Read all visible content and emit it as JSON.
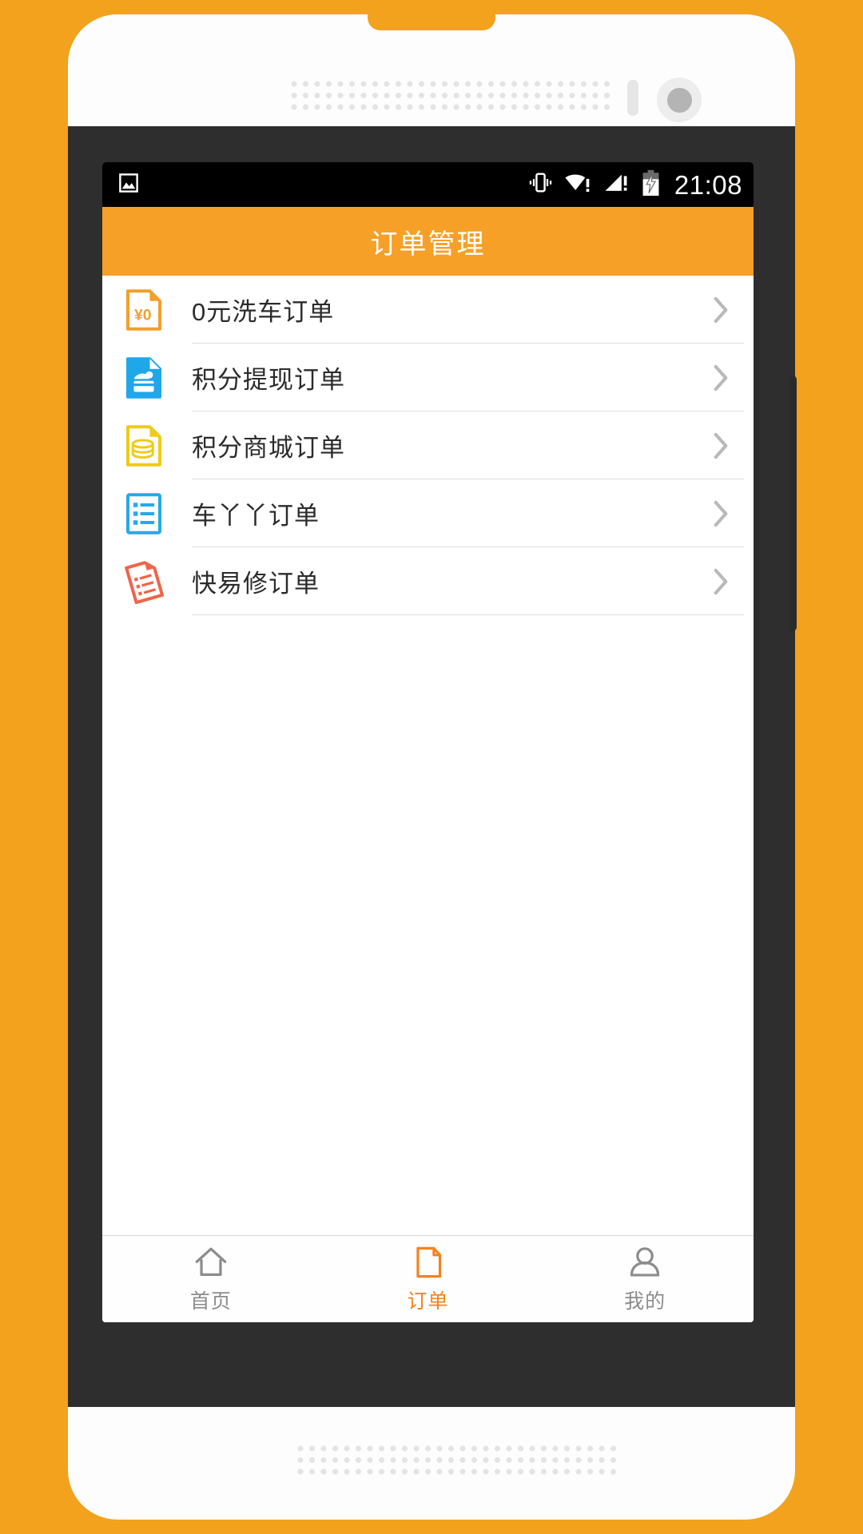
{
  "device": {
    "frame_color": "#FDFDFD",
    "bezel_color": "#2E2E2E",
    "background_color": "#F2A21C",
    "earpiece_name": "earpiece-speaker-grille",
    "camera_name": "front-camera",
    "home_name": "home-speaker-grille"
  },
  "status_bar": {
    "background": "#000000",
    "left_icons": [
      {
        "name": "image-notification-icon",
        "glyph": "picture"
      }
    ],
    "right_icons": [
      {
        "name": "vibrate-icon",
        "glyph": "vibrate"
      },
      {
        "name": "wifi-warning-icon",
        "glyph": "wifi-exclaim"
      },
      {
        "name": "cell-signal-warning-icon",
        "glyph": "signal-exclaim"
      },
      {
        "name": "battery-charging-icon",
        "glyph": "battery-bolt"
      }
    ],
    "clock": "21:08"
  },
  "title_bar": {
    "title": "订单管理",
    "background": "#F7A028",
    "text_color": "#FFFFFF"
  },
  "order_list": {
    "items": [
      {
        "label": "0元洗车订单",
        "icon_name": "zero-yuan-carwash-doc-icon",
        "icon_color": "#F2A02B",
        "icon_text": "¥0"
      },
      {
        "label": "积分提现订单",
        "icon_name": "points-withdraw-card-doc-icon",
        "icon_color": "#1FA7EA",
        "icon_text": ""
      },
      {
        "label": "积分商城订单",
        "icon_name": "points-mall-database-doc-icon",
        "icon_color": "#EFCB18",
        "icon_text": ""
      },
      {
        "label": "车丫丫订单",
        "icon_name": "cheyaya-list-doc-icon",
        "icon_color": "#26A9E8",
        "icon_text": ""
      },
      {
        "label": "快易修订单",
        "icon_name": "kuaiyixiu-tilted-list-doc-icon",
        "icon_color": "#F0644A",
        "icon_text": ""
      }
    ],
    "chevron_color": "#B9B9B9",
    "divider_color": "#DCDCDC"
  },
  "tab_bar": {
    "active_color": "#F58220",
    "inactive_color": "#8C8C8C",
    "items": [
      {
        "label": "首页",
        "icon_name": "home-icon",
        "active": false
      },
      {
        "label": "订单",
        "icon_name": "document-icon",
        "active": true
      },
      {
        "label": "我的",
        "icon_name": "person-icon",
        "active": false
      }
    ]
  }
}
